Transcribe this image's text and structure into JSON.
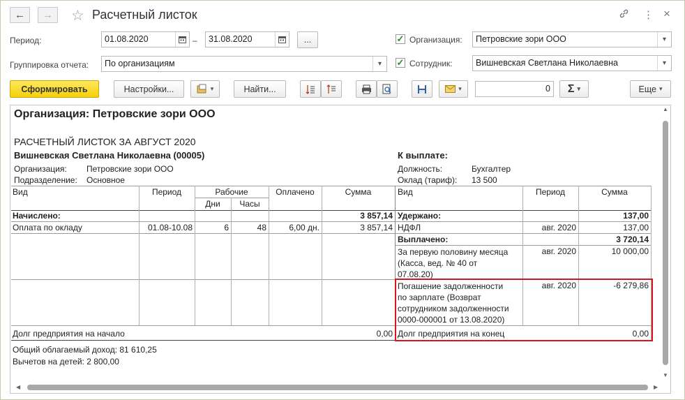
{
  "window": {
    "title": "Расчетный листок",
    "back_icon": "←",
    "forward_icon": "→",
    "star_icon": "☆",
    "link_icon": "🔗",
    "more_icon": "⋮",
    "close_icon": "×"
  },
  "form": {
    "period_label": "Период:",
    "period_from": "01.08.2020",
    "period_dash": "–",
    "period_to": "31.08.2020",
    "period_more": "...",
    "grouping_label": "Группировка отчета:",
    "grouping_value": "По организациям",
    "org_label": "Организация:",
    "org_value": "Петровские зори ООО",
    "org_checked": true,
    "employee_label": "Сотрудник:",
    "employee_value": "Вишневская Светлана Николаевна",
    "employee_checked": true
  },
  "toolbar": {
    "generate": "Сформировать",
    "settings": "Настройки...",
    "find": "Найти...",
    "number_value": "0",
    "sum_icon": "Σ",
    "more": "Еще"
  },
  "report": {
    "org_heading": "Организация: Петровские зори ООО",
    "doc_title": "РАСЧЕТНЫЙ ЛИСТОК ЗА АВГУСТ 2020",
    "employee_name": "Вишневская Светлана Николаевна (00005)",
    "org_row_label": "Организация:",
    "org_row_value": "Петровские зори ООО",
    "dept_row_label": "Подразделение:",
    "dept_row_value": "Основное",
    "to_pay_label": "К выплате:",
    "position_label": "Должность:",
    "position_value": "Бухгалтер",
    "salary_label": "Оклад (тариф):",
    "salary_value": "13 500",
    "left_headers": {
      "type": "Вид",
      "period": "Период",
      "working": "Рабочие",
      "days": "Дни",
      "hours": "Часы",
      "paid": "Оплачено",
      "sum": "Сумма"
    },
    "right_headers": {
      "type": "Вид",
      "period": "Период",
      "sum": "Сумма"
    },
    "accrued_label": "Начислено:",
    "accrued_total": "3 857,14",
    "accrual_row": {
      "type": "Оплата по окладу",
      "period": "01.08-10.08",
      "days": "6",
      "hours": "48",
      "paid": "6,00 дн.",
      "sum": "3 857,14"
    },
    "withheld_label": "Удержано:",
    "withheld_total": "137,00",
    "ndfl_row": {
      "type": "НДФЛ",
      "period": "авг. 2020",
      "sum": "137,00"
    },
    "paid_label": "Выплачено:",
    "paid_total": "3 720,14",
    "payout_row": {
      "type_lines": [
        "За первую половину месяца",
        "(Касса, вед. № 40 от",
        "07.08.20)"
      ],
      "period": "авг. 2020",
      "sum": "10 000,00"
    },
    "debt_row": {
      "type_lines": [
        "Погашение задолженности",
        "по зарплате (Возврат",
        "сотрудником задолженности",
        "0000-000001 от 13.08.2020)"
      ],
      "period": "авг. 2020",
      "sum": "-6 279,86"
    },
    "debt_start_label": "Долг предприятия на начало",
    "debt_start_value": "0,00",
    "debt_end_label": "Долг предприятия на конец",
    "debt_end_value": "0,00",
    "taxable_income": "Общий облагаемый доход: 81 610,25",
    "child_deductions": "Вычетов на детей: 2 800,00"
  }
}
